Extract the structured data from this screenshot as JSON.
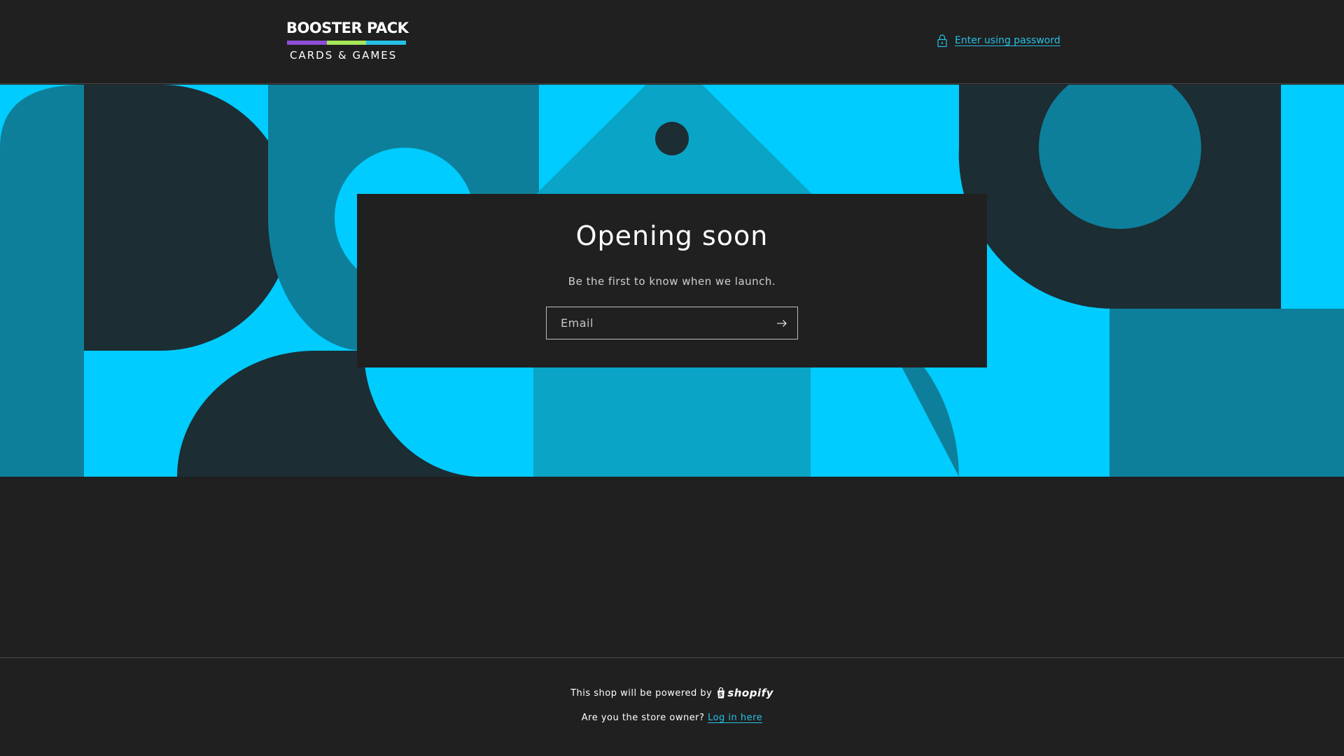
{
  "header": {
    "logo": {
      "title": "BOOSTER PACK",
      "subtitle": "CARDS & GAMES",
      "stripe_colors": [
        "#8e4fd6",
        "#a6e85a",
        "#26c1e6"
      ]
    },
    "password_link": {
      "label": "Enter using password",
      "icon": "lock-icon"
    }
  },
  "banner": {
    "colors": {
      "cyan": "#00ccff",
      "teal": "#0e7f9a",
      "mid": "#0aa4c7",
      "dark": "#1c2d33"
    }
  },
  "card": {
    "title": "Opening soon",
    "subtitle": "Be the first to know when we launch.",
    "email_placeholder": "Email",
    "submit_icon": "arrow-right-icon"
  },
  "footer": {
    "powered_text": "This shop will be powered by",
    "shopify_label": "shopify",
    "owner_question": "Are you the store owner?",
    "login_link": "Log in here"
  },
  "colors": {
    "background": "#202020",
    "accent": "#26c1e6",
    "text": "#ffffff"
  }
}
